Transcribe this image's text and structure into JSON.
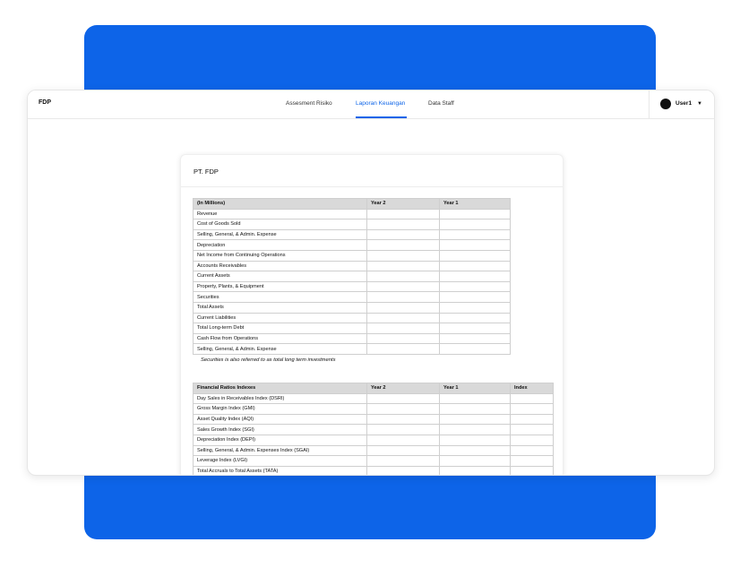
{
  "colors": {
    "accent": "#0d64e8",
    "header_gray": "#d9d9d9"
  },
  "app": {
    "brand": "FDP"
  },
  "nav": {
    "tabs": [
      {
        "label": "Assesment Risiko"
      },
      {
        "label": "Laporan Keuangan",
        "active": true
      },
      {
        "label": "Data Staff"
      }
    ]
  },
  "user": {
    "name": "User1",
    "avatar_icon": "avatar-circle",
    "caret_icon": "chevron-down-icon"
  },
  "card": {
    "title": "PT. FDP"
  },
  "table1": {
    "headers": [
      "(In Millions)",
      "Year 2",
      "Year 1"
    ],
    "rows": [
      "Revenue",
      "Cost of Goods Sold",
      "Selling, General, & Admin. Expense",
      "Depreciation",
      "Net Income from Continuing Operations",
      "Accounts Receivables",
      "Current Assets",
      "Property, Plants, & Equipment",
      "Securities",
      "Total Assets",
      "Current Liabilities",
      "Total Long-term Debt",
      "Cash Flow from Operations",
      "Selling, General, & Admin. Expense"
    ],
    "note": "Securities is also referred to as total long term investments"
  },
  "table2": {
    "headers": [
      "Financial Ratios Indexes",
      "Year 2",
      "Year 1",
      "Index"
    ],
    "rows": [
      "Day Sales in Receivables Index (DSRI)",
      "Gross Margin Index (GMI)",
      "Asset Quality Index (AQI)",
      "Sales Growth Index (SGI)",
      "Depreciation Index (DEPI)",
      "Selling, General, & Admin. Expenses Index (SGAI)",
      "Leverage Index (LVGI)",
      "Total Accruals to Total Assets (TATA)"
    ]
  }
}
